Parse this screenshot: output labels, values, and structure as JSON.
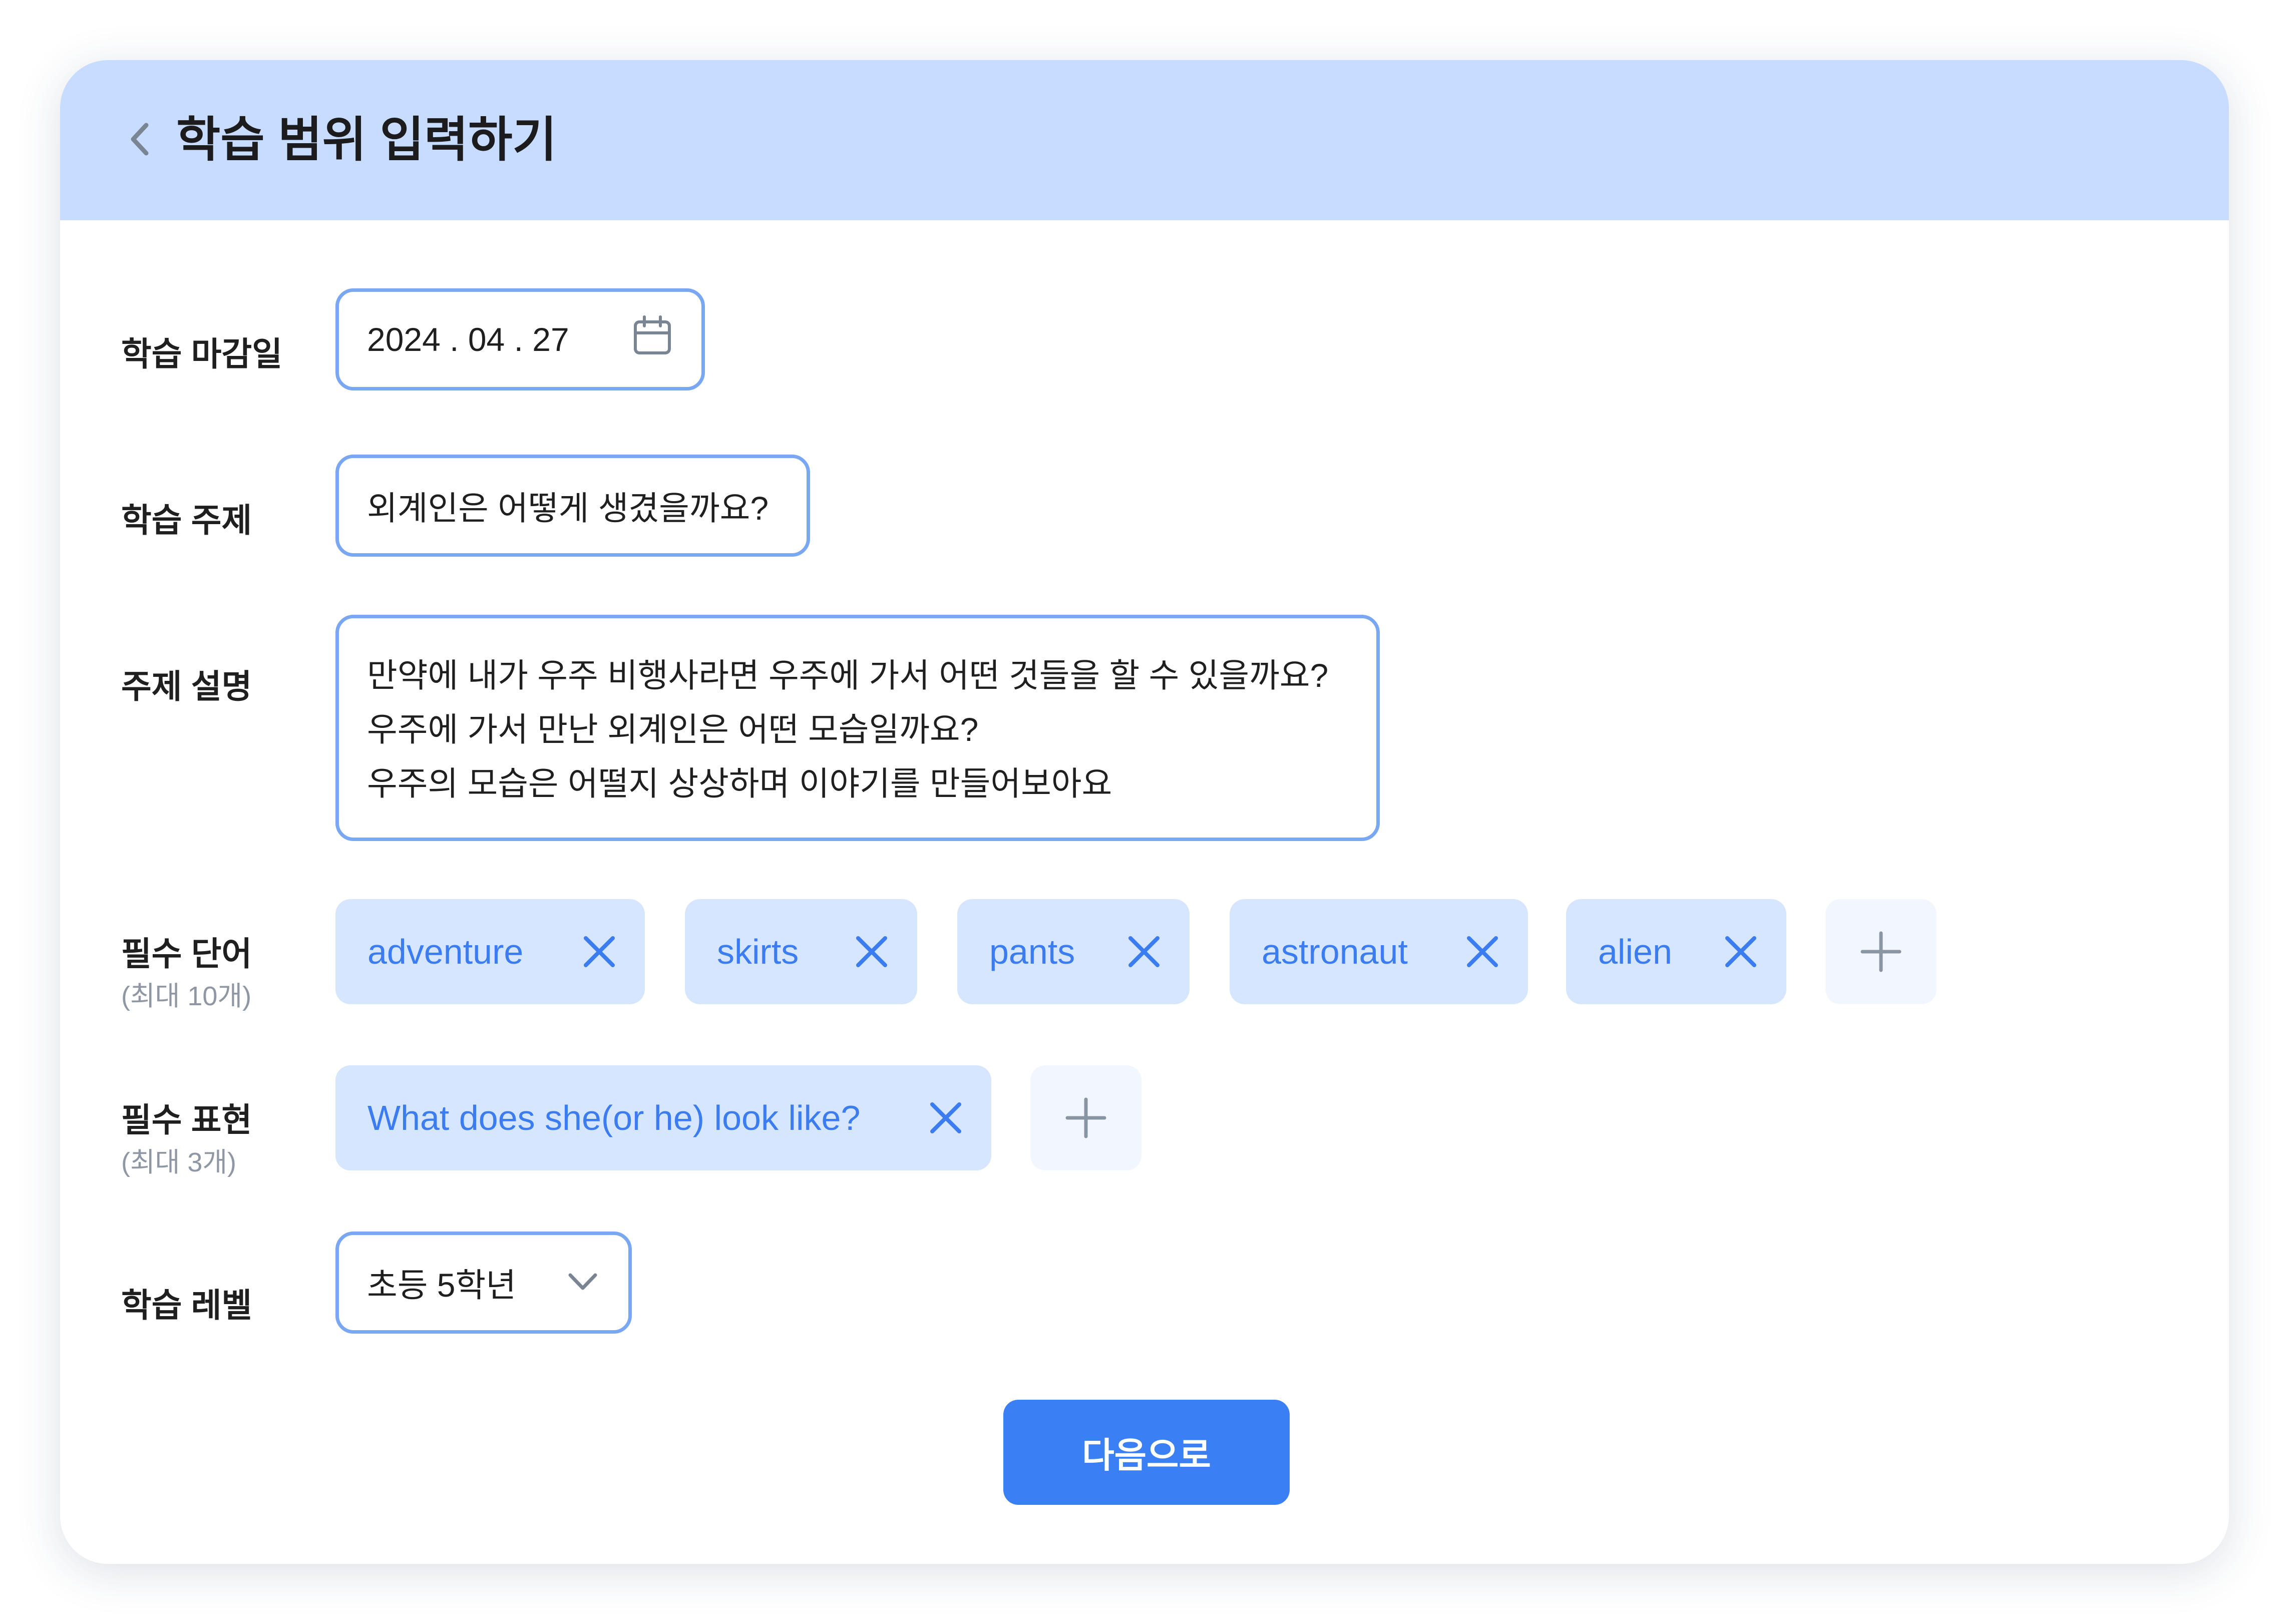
{
  "header": {
    "title": "학습 범위 입력하기",
    "back_icon": "chevron-left-icon"
  },
  "form": {
    "deadline": {
      "label": "학습 마감일",
      "value": "2024 . 04 . 27",
      "icon": "calendar-icon"
    },
    "topic": {
      "label": "학습 주제",
      "value": "외계인은 어떻게 생겼을까요?"
    },
    "description": {
      "label": "주제 설명",
      "lines": [
        "만약에 내가 우주 비행사라면 우주에 가서 어떤 것들을 할 수 있을까요?",
        "우주에 가서 만난 외계인은 어떤 모습일까요?",
        "우주의 모습은 어떨지 상상하며 이야기를 만들어보아요"
      ]
    },
    "required_words": {
      "label": "필수 단어",
      "sublabel": "(최대 10개)",
      "items": [
        "adventure",
        "skirts",
        "pants",
        "astronaut",
        "alien"
      ]
    },
    "required_expressions": {
      "label": "필수 표현",
      "sublabel": "(최대 3개)",
      "items": [
        "What does she(or he) look like?"
      ]
    },
    "level": {
      "label": "학습 레벨",
      "value": "초등 5학년",
      "icon": "chevron-down-icon"
    }
  },
  "actions": {
    "next_label": "다음으로"
  },
  "colors": {
    "header_bg": "#c8dcff",
    "field_border": "#7aa7f2",
    "chip_bg": "#d6e6ff",
    "chip_text": "#3b7df0",
    "primary_button": "#3b7ff5"
  }
}
